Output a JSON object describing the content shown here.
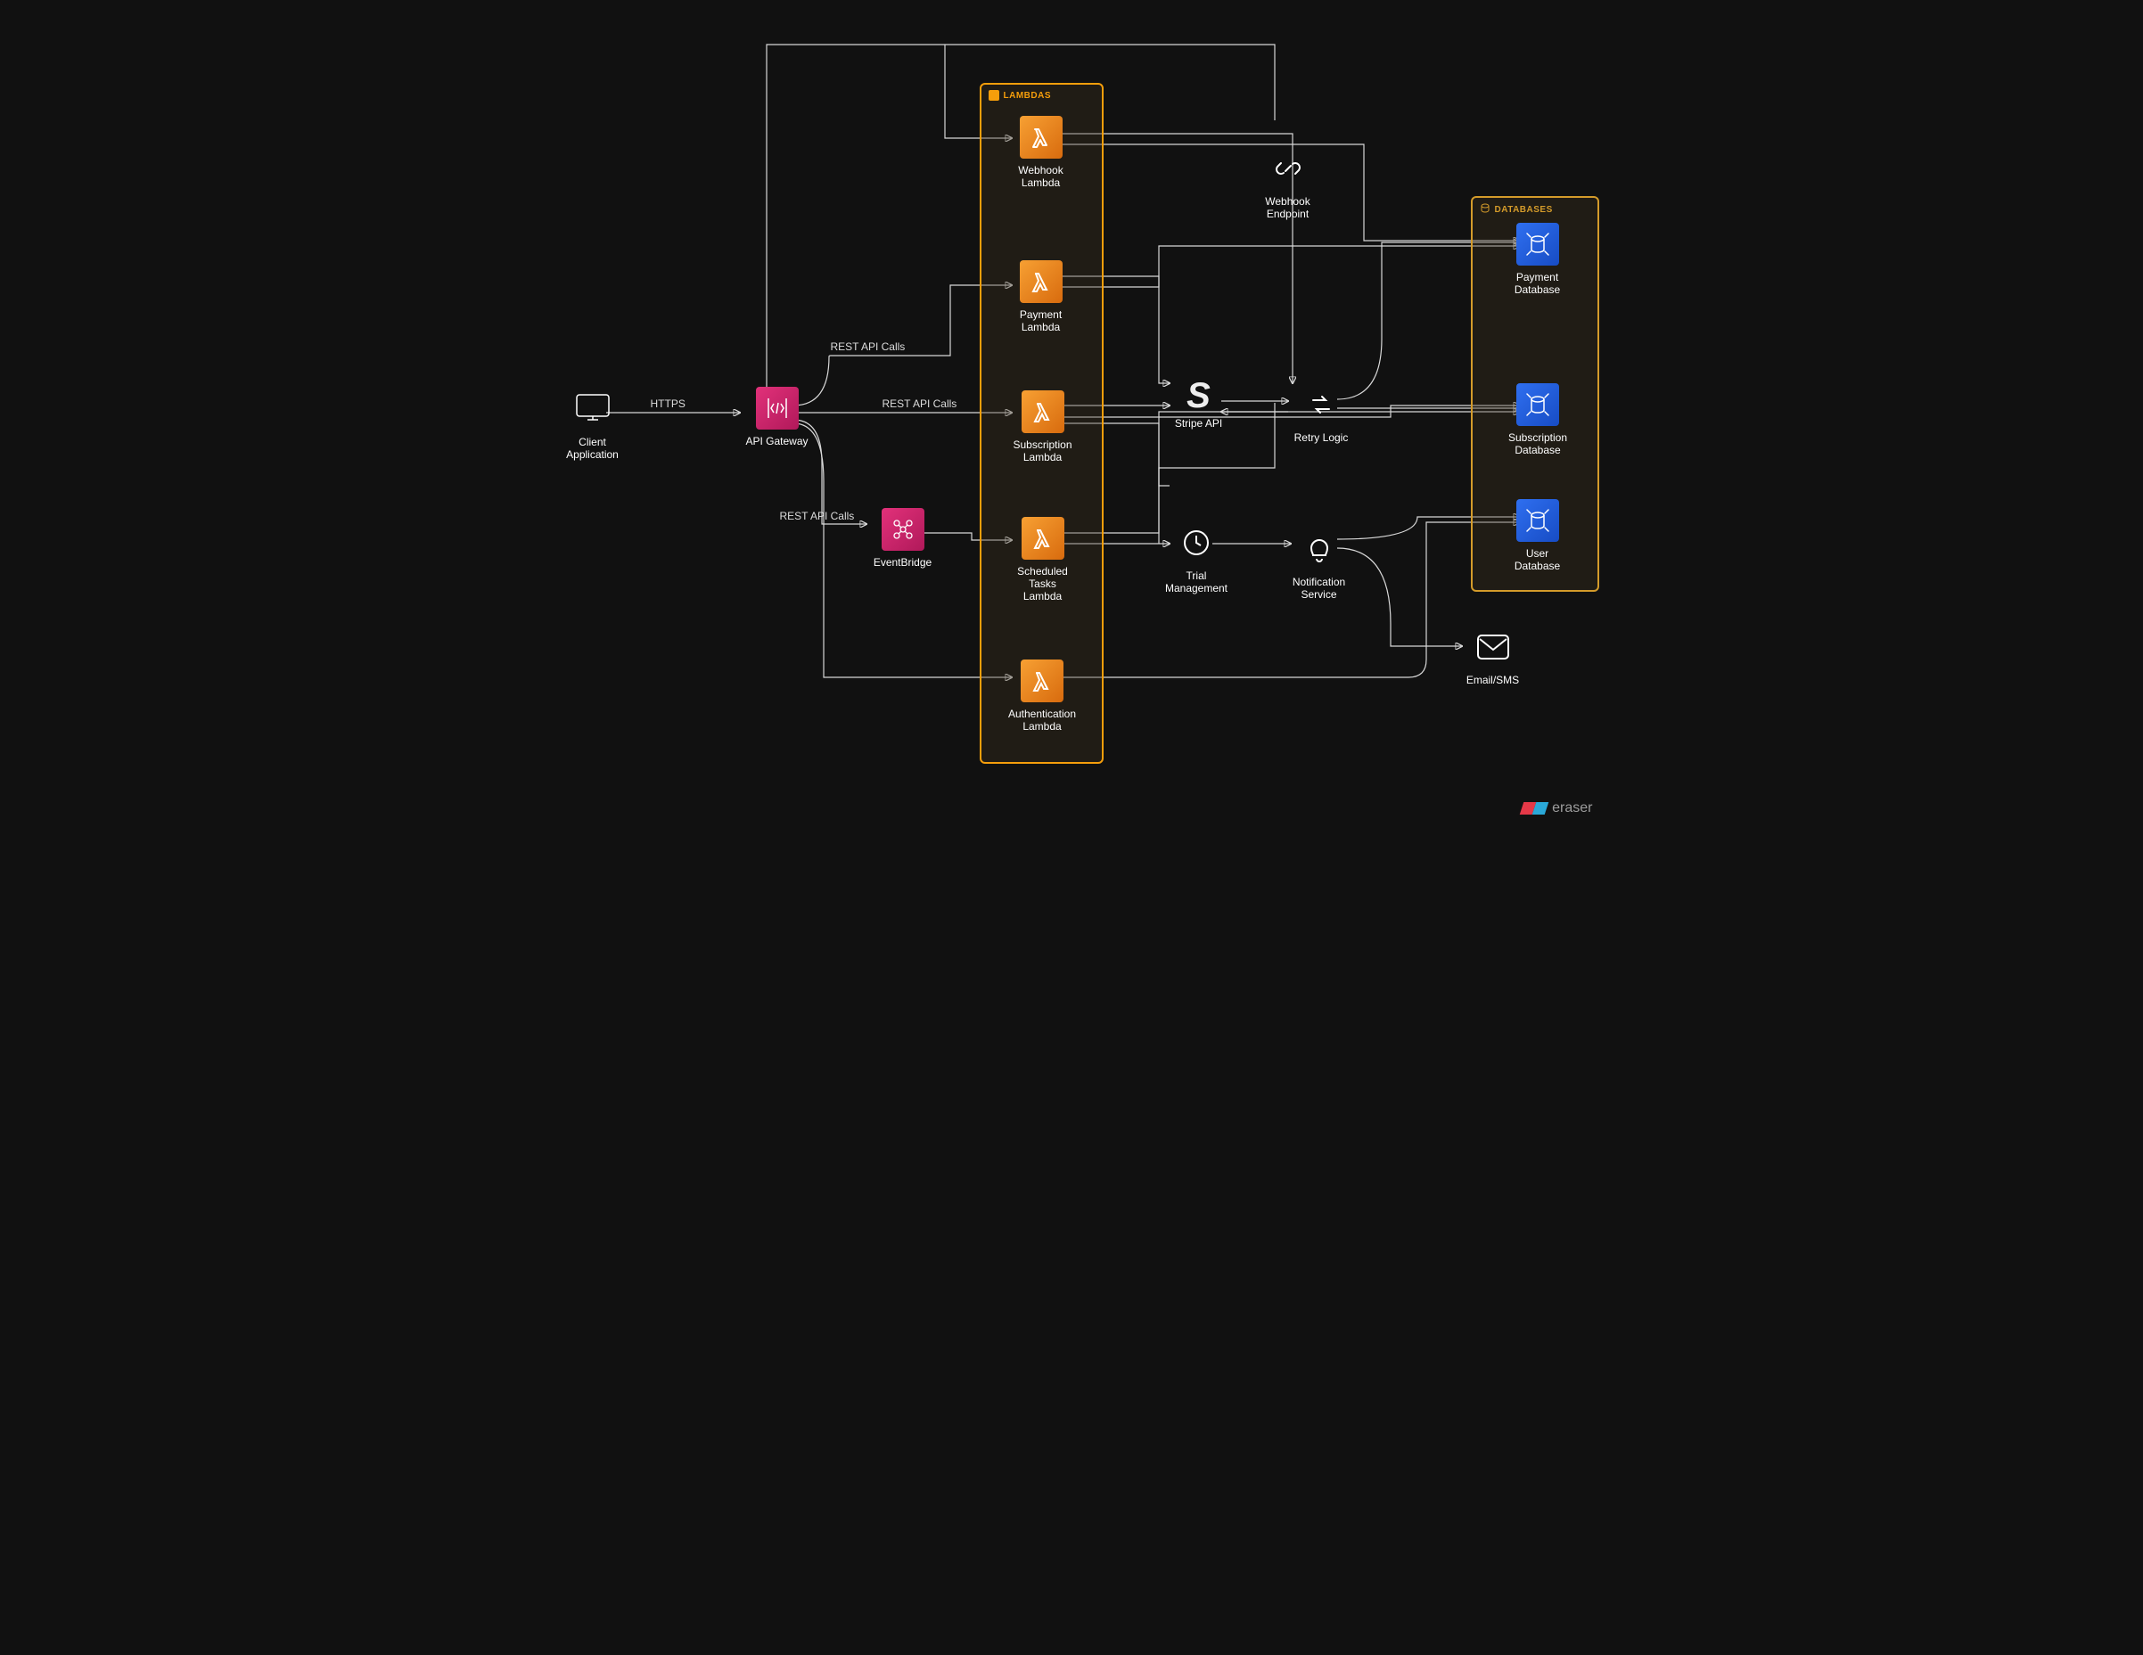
{
  "groups": {
    "lambdas": {
      "title": "LAMBDAS"
    },
    "databases": {
      "title": "DATABASES"
    }
  },
  "nodes": {
    "client": "Client\nApplication",
    "gateway": "API Gateway",
    "eventbridge": "EventBridge",
    "webhookL": "Webhook\nLambda",
    "paymentL": "Payment\nLambda",
    "subL": "Subscription\nLambda",
    "schedL": "Scheduled\nTasks\nLambda",
    "authL": "Authentication\nLambda",
    "stripe": "Stripe API",
    "webhookE": "Webhook\nEndpoint",
    "retry": "Retry Logic",
    "trial": "Trial\nManagement",
    "notif": "Notification\nService",
    "payDB": "Payment\nDatabase",
    "subDB": "Subscription\nDatabase",
    "userDB": "User\nDatabase",
    "email": "Email/SMS"
  },
  "edges": {
    "https": "HTTPS",
    "rest1": "REST API Calls",
    "rest2": "REST API Calls",
    "rest3": "REST API Calls"
  },
  "brand": "eraser"
}
